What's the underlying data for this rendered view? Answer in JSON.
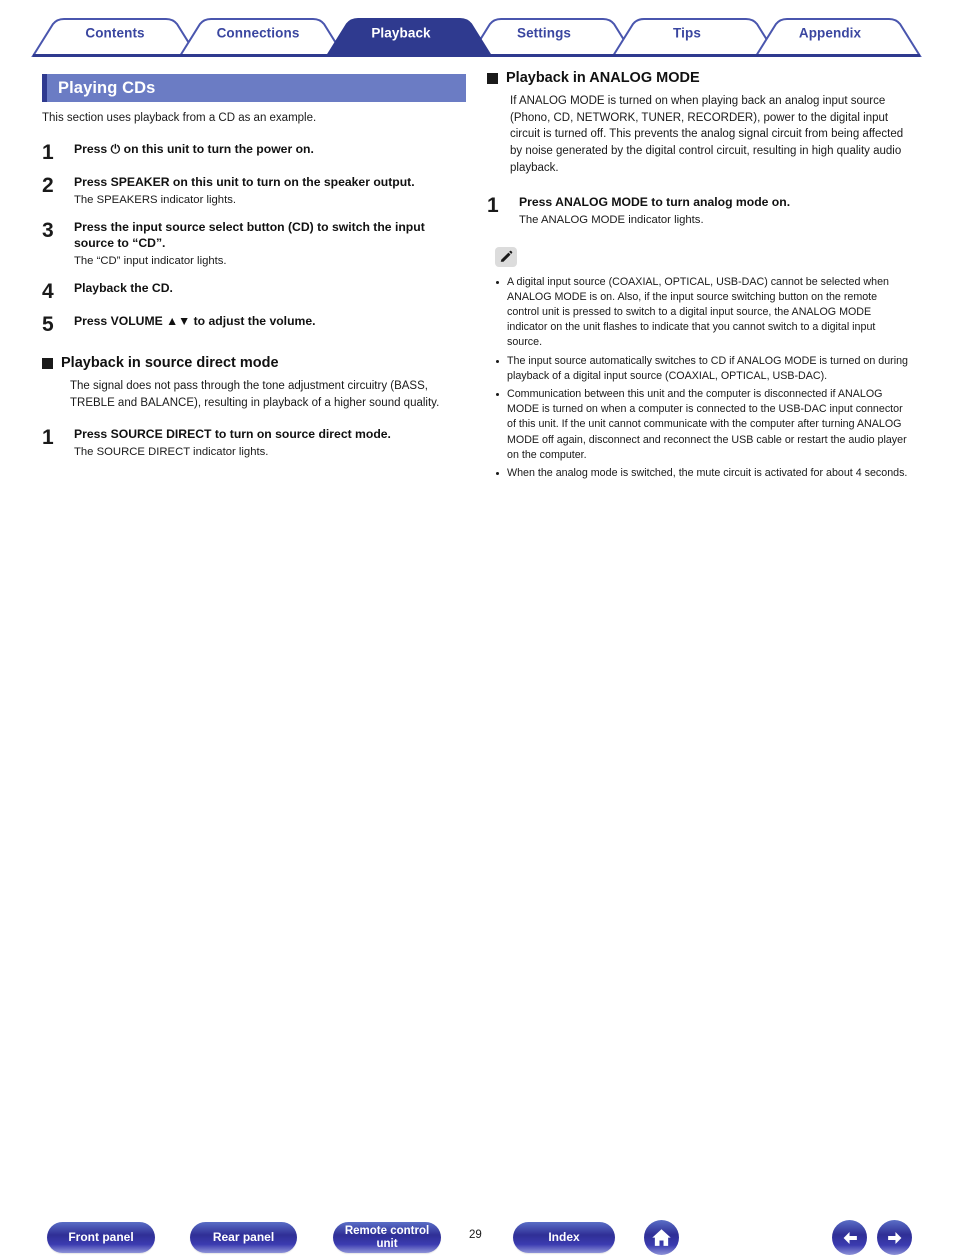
{
  "tabs": [
    {
      "label": "Contents",
      "active": false
    },
    {
      "label": "Connections",
      "active": false
    },
    {
      "label": "Playback",
      "active": true
    },
    {
      "label": "Settings",
      "active": false
    },
    {
      "label": "Tips",
      "active": false
    },
    {
      "label": "Appendix",
      "active": false
    }
  ],
  "colors": {
    "tab_border": "#4a56ae",
    "tab_active_fill": "#2f3a8f",
    "tab_text": "#3a46a0",
    "title_band": "#6b7cc4",
    "title_accent": "#2f3a8f",
    "footer_button": "#2f2f96"
  },
  "left": {
    "title": "Playing CDs",
    "intro": "This section uses playback from a CD as an example.",
    "steps": [
      {
        "num": "1",
        "head": "Press ⏻ on this unit to turn the power on.",
        "sub": ""
      },
      {
        "num": "2",
        "head": "Press SPEAKER on this unit to turn on the speaker output.",
        "sub": "The SPEAKERS indicator lights."
      },
      {
        "num": "3",
        "head": "Press the input source select button (CD) to switch the input source to “CD”.",
        "sub": "The “CD” input indicator lights."
      },
      {
        "num": "4",
        "head": "Playback the CD.",
        "sub": ""
      },
      {
        "num": "5",
        "head": "Press VOLUME ▲▼ to adjust the volume.",
        "sub": ""
      }
    ],
    "section": {
      "heading": "Playback in source direct mode",
      "paragraph": "The signal does not pass through the tone adjustment circuitry (BASS, TREBLE and BALANCE), resulting in playback of a higher sound quality.",
      "steps": [
        {
          "num": "1",
          "head": "Press SOURCE DIRECT to turn on source direct mode.",
          "sub": "The SOURCE DIRECT indicator lights."
        }
      ]
    }
  },
  "right": {
    "section": {
      "heading": "Playback in ANALOG MODE",
      "paragraph": "If ANALOG MODE is turned on when playing back an analog input source (Phono, CD, NETWORK, TUNER, RECORDER), power to the digital input circuit is turned off. This prevents the analog signal circuit from being affected by noise generated by the digital control circuit, resulting in high quality audio playback.",
      "steps": [
        {
          "num": "1",
          "head": "Press ANALOG MODE to turn analog mode on.",
          "sub": "The ANALOG MODE indicator lights."
        }
      ]
    },
    "note_bullets": [
      "A digital input source (COAXIAL, OPTICAL, USB-DAC) cannot be selected when ANALOG MODE is on. Also, if the input source switching button on the remote control unit is pressed to switch to a digital input source, the ANALOG MODE indicator on the unit flashes to indicate that you cannot switch to a digital input source.",
      "The input source automatically switches to CD if ANALOG MODE is turned on during playback of a digital input source (COAXIAL, OPTICAL, USB-DAC).",
      "Communication between this unit and the computer is disconnected if ANALOG MODE is turned on when a computer is connected to the USB-DAC input connector of this unit. If the unit cannot communicate with the computer after turning ANALOG MODE off again, disconnect and reconnect the USB cable or restart the audio player on the computer.",
      "When the analog mode is switched, the mute circuit is activated for about 4 seconds."
    ]
  },
  "footer": {
    "front_panel": "Front panel",
    "rear_panel": "Rear panel",
    "remote_control": "Remote control unit",
    "page_number": "29",
    "index": "Index",
    "home_icon": "home-icon",
    "prev_icon": "arrow-left-icon",
    "next_icon": "arrow-right-icon"
  }
}
